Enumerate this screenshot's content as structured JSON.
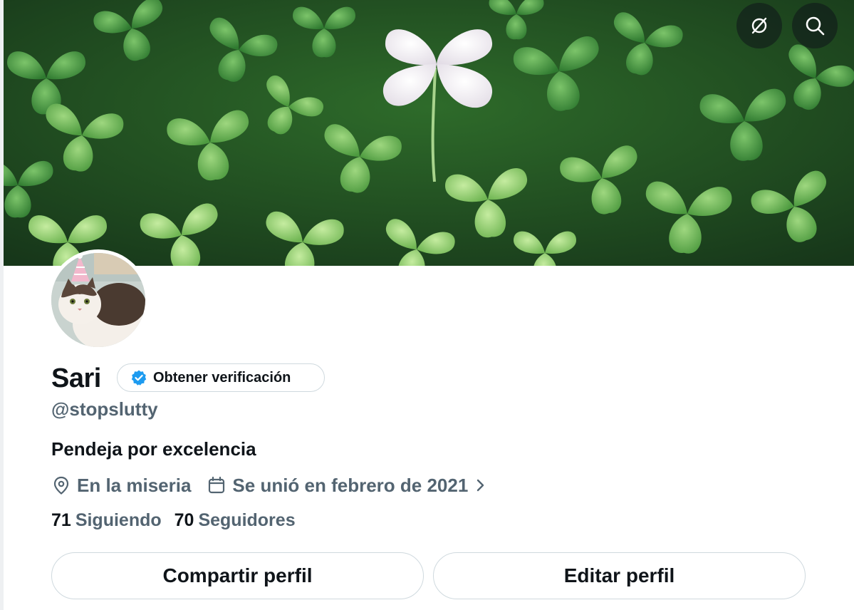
{
  "header": {
    "translate_icon": "translate-slash-icon",
    "search_icon": "search-icon"
  },
  "banner": {
    "subject": "clover-field-image"
  },
  "avatar": {
    "subject": "cat-with-party-hat"
  },
  "profile": {
    "name": "Sari",
    "verification_label": "Obtener verificación",
    "handle": "@stopslutty",
    "bio": "Pendeja por excelencia",
    "location": "En la miseria",
    "joined": "Se unió en febrero de 2021",
    "following_count": "71",
    "following_label": "Siguiendo",
    "followers_count": "70",
    "followers_label": "Seguidores"
  },
  "buttons": {
    "share": "Compartir perfil",
    "edit": "Editar perfil"
  },
  "colors": {
    "verify_badge": "#1d9bf0",
    "secondary_text": "#536471",
    "border": "#cfd9de"
  }
}
